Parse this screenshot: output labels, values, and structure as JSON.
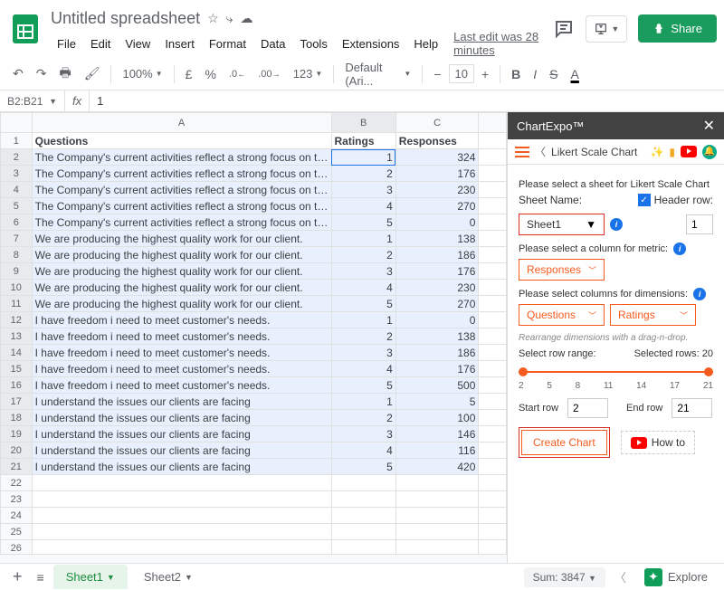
{
  "doc": {
    "title": "Untitled spreadsheet",
    "last_edit": "Last edit was 28 minutes"
  },
  "menu": [
    "File",
    "Edit",
    "View",
    "Insert",
    "Format",
    "Data",
    "Tools",
    "Extensions",
    "Help"
  ],
  "share_btn": "Share",
  "toolbar": {
    "zoom": "100%",
    "currency": "£",
    "pct": "%",
    "dec1": ".0",
    "dec2": ".00",
    "num": "123",
    "font": "Default (Ari...",
    "fontsize": "10"
  },
  "namebox": "B2:B21",
  "fx_value": "1",
  "columns": [
    "A",
    "B",
    "C"
  ],
  "sheet": {
    "headers": {
      "q": "Questions",
      "r": "Ratings",
      "resp": "Responses"
    },
    "rows": [
      {
        "q": "The Company's current activities reflect a strong focus on the client.",
        "r": 1,
        "resp": 324
      },
      {
        "q": "The Company's current activities reflect a strong focus on the client.",
        "r": 2,
        "resp": 176
      },
      {
        "q": "The Company's current activities reflect a strong focus on the client.",
        "r": 3,
        "resp": 230
      },
      {
        "q": "The Company's current activities reflect a strong focus on the client.",
        "r": 4,
        "resp": 270
      },
      {
        "q": "The Company's current activities reflect a strong focus on the client.",
        "r": 5,
        "resp": 0
      },
      {
        "q": "We are producing the highest quality work for our client.",
        "r": 1,
        "resp": 138
      },
      {
        "q": "We are producing the highest quality work for our client.",
        "r": 2,
        "resp": 186
      },
      {
        "q": "We are producing the highest quality work for our client.",
        "r": 3,
        "resp": 176
      },
      {
        "q": "We are producing the highest quality work for our client.",
        "r": 4,
        "resp": 230
      },
      {
        "q": "We are producing the highest quality work for our client.",
        "r": 5,
        "resp": 270
      },
      {
        "q": "I have freedom i need to meet customer's needs.",
        "r": 1,
        "resp": 0
      },
      {
        "q": "I have freedom i need to meet customer's needs.",
        "r": 2,
        "resp": 138
      },
      {
        "q": "I have freedom i need to meet customer's needs.",
        "r": 3,
        "resp": 186
      },
      {
        "q": "I have freedom i need to meet customer's needs.",
        "r": 4,
        "resp": 176
      },
      {
        "q": "I have freedom i need to meet customer's needs.",
        "r": 5,
        "resp": 500
      },
      {
        "q": "I understand the issues our clients are facing",
        "r": 1,
        "resp": 5
      },
      {
        "q": "I understand the issues our clients are facing",
        "r": 2,
        "resp": 100
      },
      {
        "q": "I understand the issues our clients are facing",
        "r": 3,
        "resp": 146
      },
      {
        "q": "I understand the issues our clients are facing",
        "r": 4,
        "resp": 116
      },
      {
        "q": "I understand the issues our clients are facing",
        "r": 5,
        "resp": 420
      }
    ]
  },
  "sidebar": {
    "title": "ChartExpo™",
    "chart_type": "Likert Scale Chart",
    "msg_select_sheet": "Please select a sheet for Likert Scale Chart",
    "sheet_name_lbl": "Sheet Name:",
    "sheet_sel": "Sheet1",
    "header_row_lbl": "Header row:",
    "header_row_val": "1",
    "msg_metric": "Please select a column for metric:",
    "metric_sel": "Responses",
    "msg_dims": "Please select columns for dimensions:",
    "dim1_sel": "Questions",
    "dim2_sel": "Ratings",
    "hint_drag": "Rearrange dimensions with a drag-n-drop.",
    "range_lbl": "Select row range:",
    "sel_rows_lbl": "Selected rows: 20",
    "ticks": [
      "2",
      "5",
      "8",
      "11",
      "14",
      "17",
      "21"
    ],
    "start_lbl": "Start row",
    "start_val": "2",
    "end_lbl": "End row",
    "end_val": "21",
    "create_btn": "Create Chart",
    "howto_btn": "How to"
  },
  "footer": {
    "sheet1": "Sheet1",
    "sheet2": "Sheet2",
    "sum": "Sum: 3847",
    "explore": "Explore"
  }
}
